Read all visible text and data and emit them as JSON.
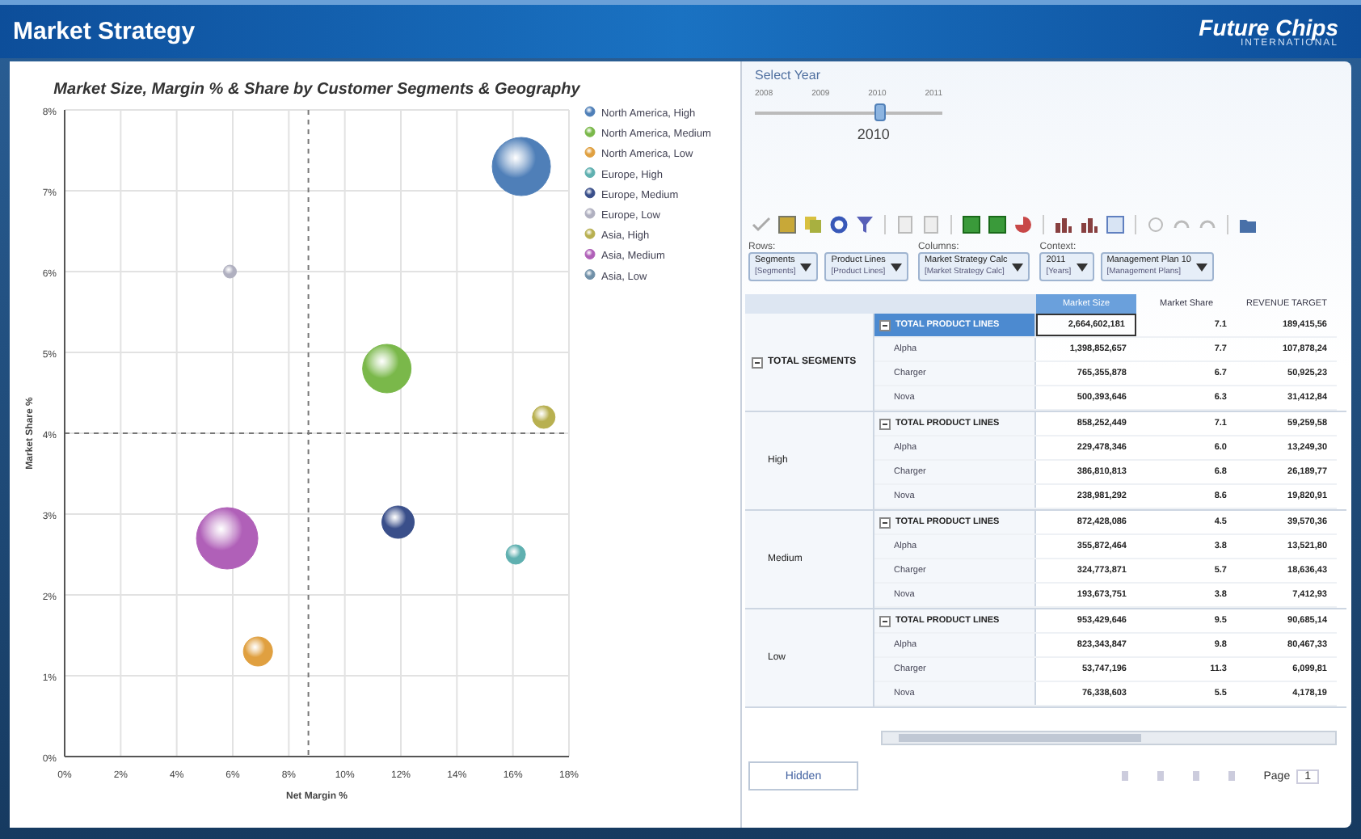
{
  "window": {
    "title": "Market Strategy",
    "logo": "Future Chips",
    "logo_sub": "INTERNATIONAL"
  },
  "chart": {
    "chart_data": {
      "type": "scatter",
      "title": "Market Size, Margin % & Share by Customer Segments & Geography",
      "xlabel": "Net Margin %",
      "ylabel": "Market Share %",
      "xlim": [
        0,
        18
      ],
      "ylim": [
        0,
        8
      ],
      "xticks": [
        {
          "value": 0,
          "label": "0%"
        },
        {
          "value": 2,
          "label": "2%"
        },
        {
          "value": 4,
          "label": "4%"
        },
        {
          "value": 6,
          "label": "6%"
        },
        {
          "value": 8,
          "label": "8%"
        },
        {
          "value": 10,
          "label": "10%"
        },
        {
          "value": 12,
          "label": "12%"
        },
        {
          "value": 14,
          "label": "14%"
        },
        {
          "value": 16,
          "label": "16%"
        },
        {
          "value": 18,
          "label": "18%"
        }
      ],
      "yticks": [
        {
          "value": 0,
          "label": "0%"
        },
        {
          "value": 1,
          "label": "1%"
        },
        {
          "value": 2,
          "label": "2%"
        },
        {
          "value": 3,
          "label": "3%"
        },
        {
          "value": 4,
          "label": "4%"
        },
        {
          "value": 5,
          "label": "5%"
        },
        {
          "value": 6,
          "label": "6%"
        },
        {
          "value": 7,
          "label": "7%"
        },
        {
          "value": 8,
          "label": "8%"
        }
      ],
      "grid": true,
      "legend": "right",
      "ref_lines": [
        {
          "axis": "x",
          "value": 8.7
        },
        {
          "axis": "y",
          "value": 4
        }
      ],
      "x": [
        5.8,
        5.9,
        6.9,
        11.5,
        11.9,
        16.1,
        16.3,
        17.1
      ],
      "series": [
        {
          "name": "North America, High",
          "color": "#4f7fb8",
          "values": [
            null,
            null,
            null,
            null,
            null,
            null,
            7.3,
            null
          ]
        },
        {
          "name": "North America, Medium",
          "color": "#7ab84a",
          "values": [
            null,
            null,
            null,
            4.8,
            null,
            null,
            null,
            null
          ]
        },
        {
          "name": "North America, Low",
          "color": "#e0a040",
          "values": [
            null,
            null,
            1.3,
            null,
            null,
            null,
            null,
            null
          ]
        },
        {
          "name": "Europe, High",
          "color": "#5fb0b0",
          "values": [
            null,
            null,
            null,
            null,
            null,
            2.5,
            null,
            null
          ]
        },
        {
          "name": "Europe, Medium",
          "color": "#3a4f8a",
          "values": [
            null,
            null,
            null,
            null,
            2.9,
            null,
            null,
            null
          ]
        },
        {
          "name": "Europe, Low",
          "color": "#b0b0c0",
          "values": [
            null,
            6.0,
            null,
            null,
            null,
            null,
            null,
            null
          ]
        },
        {
          "name": "Asia, High",
          "color": "#b8b050",
          "values": [
            null,
            null,
            null,
            null,
            null,
            null,
            null,
            4.2
          ]
        },
        {
          "name": "Asia, Medium",
          "color": "#b060b8",
          "values": [
            2.7,
            null,
            null,
            null,
            null,
            null,
            null,
            null
          ]
        },
        {
          "name": "Asia, Low",
          "color": "#7090a8",
          "values": [
            null,
            null,
            null,
            null,
            null,
            null,
            null,
            null
          ]
        }
      ]
    }
  },
  "slider": {
    "label": "Select Year",
    "ticks": [
      "2008",
      "2009",
      "2010",
      "2011"
    ],
    "level": 0.667,
    "value": "2010"
  },
  "filters": [
    {
      "label": "Rows:",
      "dropdowns": [
        {
          "value": "Segments",
          "sub": "[Segments]"
        },
        {
          "value": "Product Lines",
          "sub": "[Product Lines]"
        }
      ]
    },
    {
      "label": "Columns:",
      "dropdowns": [
        {
          "value": "Market Strategy Calc",
          "sub": "[Market Strategy Calc]"
        }
      ]
    },
    {
      "label": "Context:",
      "dropdowns": [
        {
          "value": "2011",
          "sub": "[Years]"
        },
        {
          "value": "Management Plan 10",
          "sub": "[Management Plans]"
        }
      ]
    }
  ],
  "table": {
    "columns": [
      {
        "label": "Market Size",
        "selected": true
      },
      {
        "label": "Market Share",
        "selected": false
      },
      {
        "label": "REVENUE TARGET",
        "selected": false
      }
    ],
    "groups": [
      {
        "label": "TOTAL SEGMENTS",
        "rows": [
          {
            "product": "TOTAL PRODUCT LINES",
            "total": true,
            "selected": true,
            "cells": [
              "2,664,602,181",
              "7.1",
              "189,415,56"
            ]
          },
          {
            "product": "Alpha",
            "total": false,
            "selected": false,
            "cells": [
              "1,398,852,657",
              "7.7",
              "107,878,24"
            ]
          },
          {
            "product": "Charger",
            "total": false,
            "selected": false,
            "cells": [
              "765,355,878",
              "6.7",
              "50,925,23"
            ]
          },
          {
            "product": "Nova",
            "total": false,
            "selected": false,
            "cells": [
              "500,393,646",
              "6.3",
              "31,412,84"
            ]
          }
        ]
      },
      {
        "label": "High",
        "rows": [
          {
            "product": "TOTAL PRODUCT LINES",
            "total": true,
            "selected": false,
            "cells": [
              "858,252,449",
              "7.1",
              "59,259,58"
            ]
          },
          {
            "product": "Alpha",
            "total": false,
            "selected": false,
            "cells": [
              "229,478,346",
              "6.0",
              "13,249,30"
            ]
          },
          {
            "product": "Charger",
            "total": false,
            "selected": false,
            "cells": [
              "386,810,813",
              "6.8",
              "26,189,77"
            ]
          },
          {
            "product": "Nova",
            "total": false,
            "selected": false,
            "cells": [
              "238,981,292",
              "8.6",
              "19,820,91"
            ]
          }
        ]
      },
      {
        "label": "Medium",
        "rows": [
          {
            "product": "TOTAL PRODUCT LINES",
            "total": true,
            "selected": false,
            "cells": [
              "872,428,086",
              "4.5",
              "39,570,36"
            ]
          },
          {
            "product": "Alpha",
            "total": false,
            "selected": false,
            "cells": [
              "355,872,464",
              "3.8",
              "13,521,80"
            ]
          },
          {
            "product": "Charger",
            "total": false,
            "selected": false,
            "cells": [
              "324,773,871",
              "5.7",
              "18,636,43"
            ]
          },
          {
            "product": "Nova",
            "total": false,
            "selected": false,
            "cells": [
              "193,673,751",
              "3.8",
              "7,412,93"
            ]
          }
        ]
      },
      {
        "label": "Low",
        "rows": [
          {
            "product": "TOTAL PRODUCT LINES",
            "total": true,
            "selected": false,
            "cells": [
              "953,429,646",
              "9.5",
              "90,685,14"
            ]
          },
          {
            "product": "Alpha",
            "total": false,
            "selected": false,
            "cells": [
              "823,343,847",
              "9.8",
              "80,467,33"
            ]
          },
          {
            "product": "Charger",
            "total": false,
            "selected": false,
            "cells": [
              "53,747,196",
              "11.3",
              "6,099,81"
            ]
          },
          {
            "product": "Nova",
            "total": false,
            "selected": false,
            "cells": [
              "76,338,603",
              "5.5",
              "4,178,19"
            ]
          }
        ]
      }
    ]
  },
  "bottom_tab": {
    "label": "Hidden"
  },
  "pager": {
    "label": "Page",
    "value": "1"
  }
}
